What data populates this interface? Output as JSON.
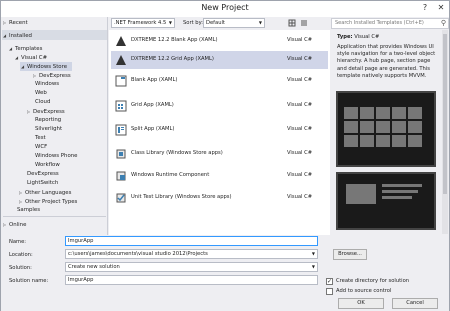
{
  "window": {
    "title": "New Project",
    "help_glyph": "?",
    "close_glyph": "✕"
  },
  "sidebar": {
    "recent": "Recent",
    "installed": "Installed",
    "templates": "Templates",
    "visual_csharp": "Visual C#",
    "windows_store": "Windows Store",
    "items": [
      "DevExpress",
      "Windows",
      "Web",
      "Cloud",
      "DevExpress",
      "Reporting",
      "Silverlight",
      "Test",
      "WCF",
      "Windows Phone",
      "Workflow",
      "DevExpress",
      "LightSwitch",
      "Other Languages",
      "Other Project Types",
      "Samples"
    ],
    "online": "Online"
  },
  "toolbar": {
    "framework": ".NET Framework 4.5",
    "sort_label": "Sort by:",
    "sort_value": "Default"
  },
  "templates": [
    {
      "name": "DXTREME 12.2 Blank App (XAML)",
      "lang": "Visual C#"
    },
    {
      "name": "DXTREME 12.2 Grid App (XAML)",
      "lang": "Visual C#"
    },
    {
      "name": "Blank App (XAML)",
      "lang": "Visual C#"
    },
    {
      "name": "Grid App (XAML)",
      "lang": "Visual C#"
    },
    {
      "name": "Split App (XAML)",
      "lang": "Visual C#"
    },
    {
      "name": "Class Library (Windows Store apps)",
      "lang": "Visual C#"
    },
    {
      "name": "Windows Runtime Component",
      "lang": "Visual C#"
    },
    {
      "name": "Unit Test Library (Windows Store apps)",
      "lang": "Visual C#"
    }
  ],
  "details": {
    "search_placeholder": "Search Installed Templates (Ctrl+E)",
    "type_label": "Type:",
    "type_value": "Visual C#",
    "description": "Application that provides Windows UI style navigation for a two-level object hierarchy. A hub page, section page and detail page are generated. This template natively supports MVVM."
  },
  "form": {
    "name_label": "Name:",
    "name_value": "ImgurApp",
    "location_label": "Location:",
    "location_value": "c:\\users\\james\\documents\\visual studio 2012\\Projects",
    "solution_label": "Solution:",
    "solution_value": "Create new solution",
    "solution_name_label": "Solution name:",
    "solution_name_value": "ImgurApp",
    "browse_label": "Browse...",
    "create_dir_label": "Create directory for solution",
    "source_control_label": "Add to source control",
    "ok_label": "OK",
    "cancel_label": "Cancel"
  },
  "colors": {
    "accent": "#007acc",
    "selected_row": "#d0d5e8"
  }
}
